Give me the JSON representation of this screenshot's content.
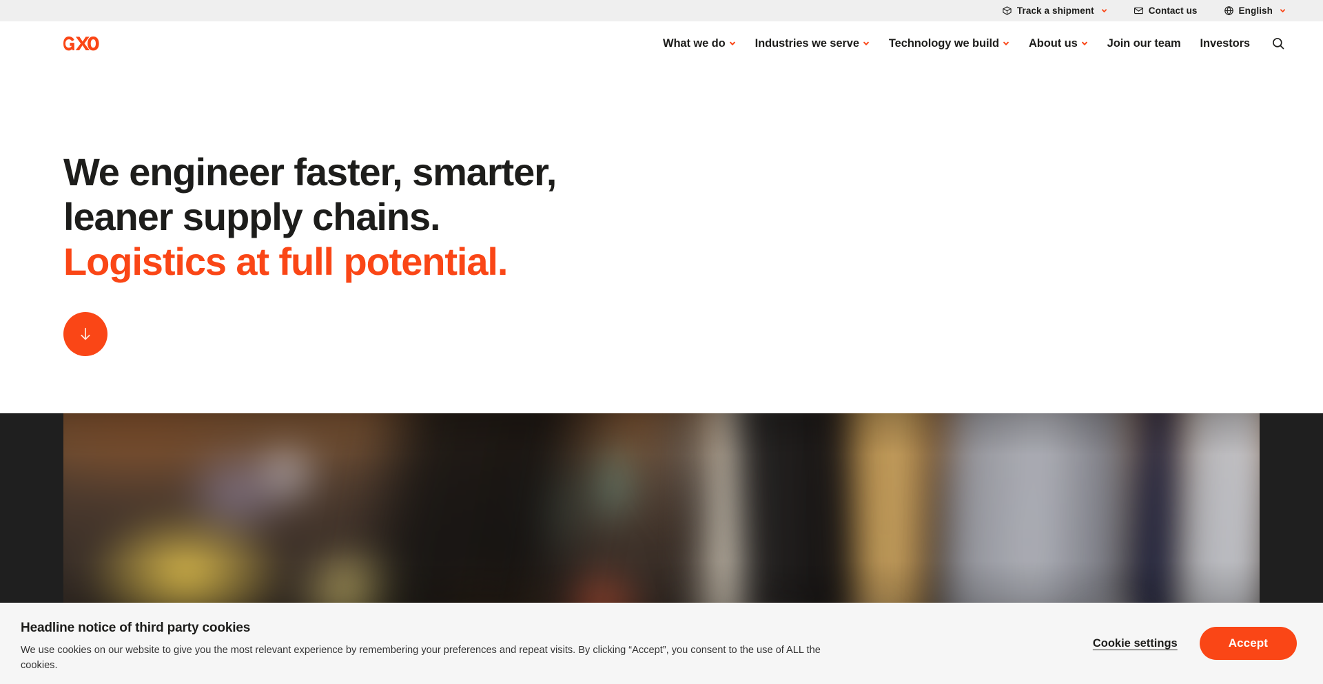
{
  "brand": {
    "name": "GXO",
    "accent_color": "#FA4616",
    "text_color": "#1D1D1B"
  },
  "utility_bar": {
    "background_color": "#EFEFEF",
    "items": [
      {
        "label": "Track a shipment",
        "icon": "package-icon",
        "has_caret": true
      },
      {
        "label": "Contact us",
        "icon": "envelope-icon",
        "has_caret": false
      },
      {
        "label": "English",
        "icon": "globe-icon",
        "has_caret": true
      }
    ]
  },
  "header": {
    "nav": [
      {
        "label": "What we do",
        "has_caret": true
      },
      {
        "label": "Industries we serve",
        "has_caret": true
      },
      {
        "label": "Technology we build",
        "has_caret": true
      },
      {
        "label": "About us",
        "has_caret": true
      },
      {
        "label": "Join our team",
        "has_caret": false
      },
      {
        "label": "Investors",
        "has_caret": false
      }
    ],
    "search_icon": "search-icon"
  },
  "hero": {
    "line1": "We engineer faster, smarter,",
    "line2": "leaner supply chains.",
    "line3_accent": "Logistics at full potential.",
    "scroll_button_icon": "arrow-down-icon"
  },
  "media": {
    "band_background_color": "#1F1F1F",
    "alt": "Blurred photo of a person in a store holding a device"
  },
  "cookie_banner": {
    "background_color": "#F6F6F6",
    "title": "Headline notice of third party cookies",
    "body": "We use cookies on our website to give you the most relevant experience by remembering your preferences and repeat visits. By clicking “Accept”, you consent to the use of ALL the cookies.",
    "settings_label": "Cookie settings",
    "accept_label": "Accept"
  }
}
